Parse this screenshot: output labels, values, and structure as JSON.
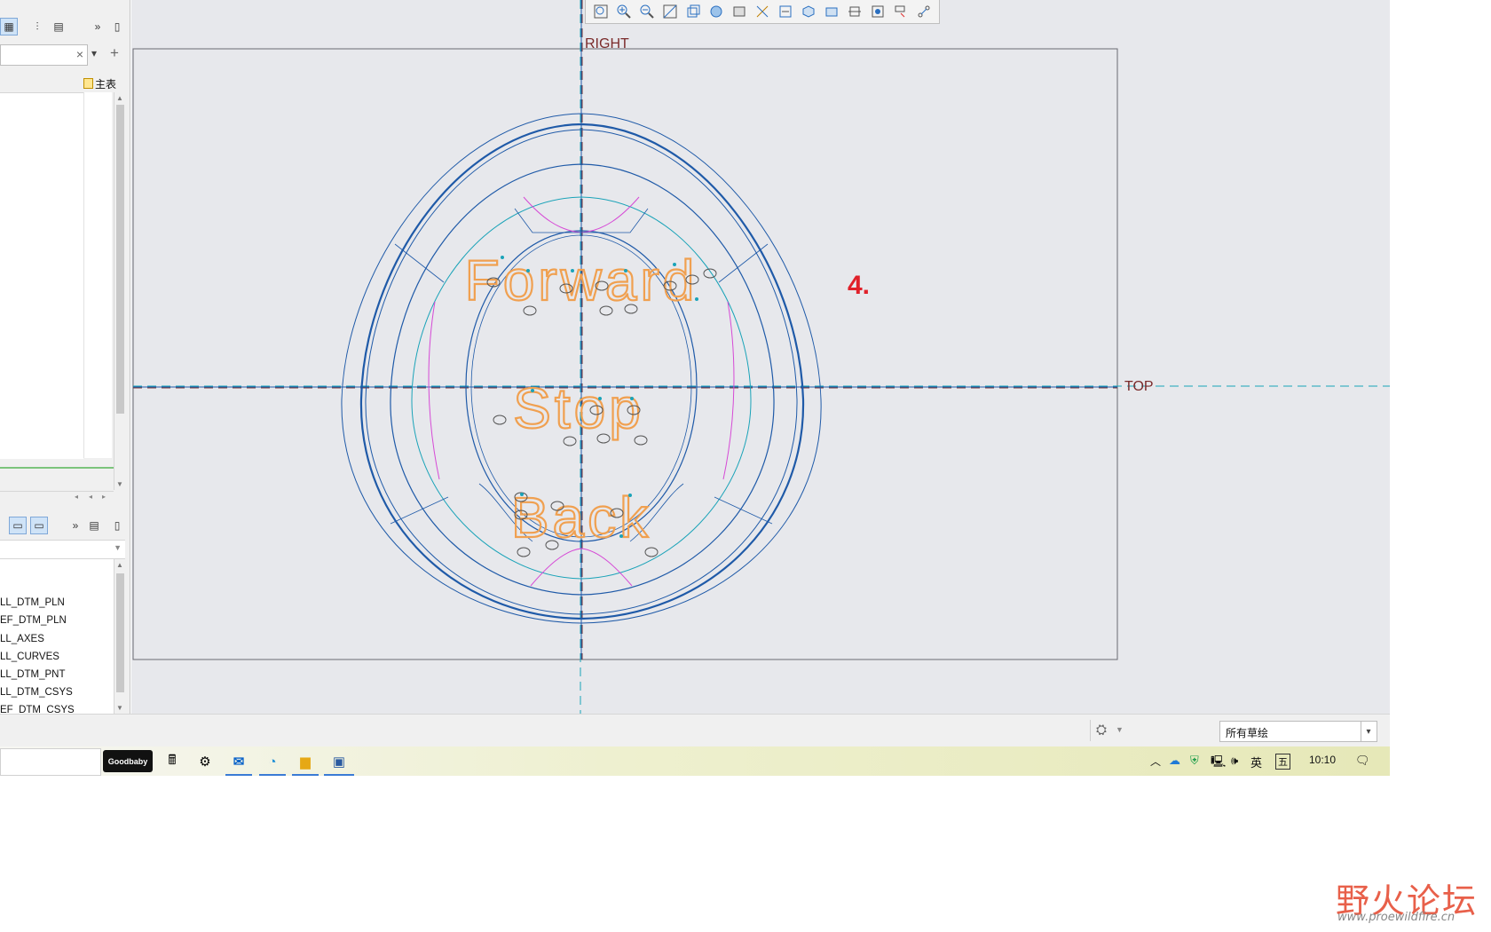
{
  "left_panel": {
    "toolbar_overflow": "»",
    "search": {
      "value": "",
      "clear": "×",
      "dropdown": "▾",
      "add": "+"
    },
    "tree_header": "主表",
    "layer_toolbar_overflow": "»",
    "layers": [
      "LL_DTM_PLN",
      "EF_DTM_PLN",
      "LL_AXES",
      "LL_CURVES",
      "LL_DTM_PNT",
      "EF_DTM_CSYS",
      "EF_DTM_CSYS"
    ]
  },
  "layer_labels_fixed": [
    "LL_DTM_PLN",
    "EF_DTM_PLN",
    "LL_AXES",
    "LL_CURVES",
    "LL_DTM_PNT",
    "LL_DTM_CSYS",
    "EF_DTM_CSYS"
  ],
  "graphics": {
    "datum_right": "RIGHT",
    "datum_top": "TOP",
    "step_label": "4.",
    "text_forward": "Forward",
    "text_stop": "Stop",
    "text_back": "Back"
  },
  "status_bar": {
    "filter_value": "所有草绘",
    "filter_arrow": "▾"
  },
  "taskbar": {
    "app_badge": "Goodbaby",
    "ime_lang": "英",
    "ime_mode": "五",
    "clock": "10:10"
  },
  "watermark": {
    "title": "野火论坛",
    "url": "www.proewildfire.cn"
  },
  "colors": {
    "sketch_blue": "#1f5aa8",
    "cyan": "#1aa3b8",
    "magenta": "#d64ad6",
    "orange_text": "#f0a050",
    "step_red": "#e0202a",
    "datum_label": "#7a2a2a"
  }
}
